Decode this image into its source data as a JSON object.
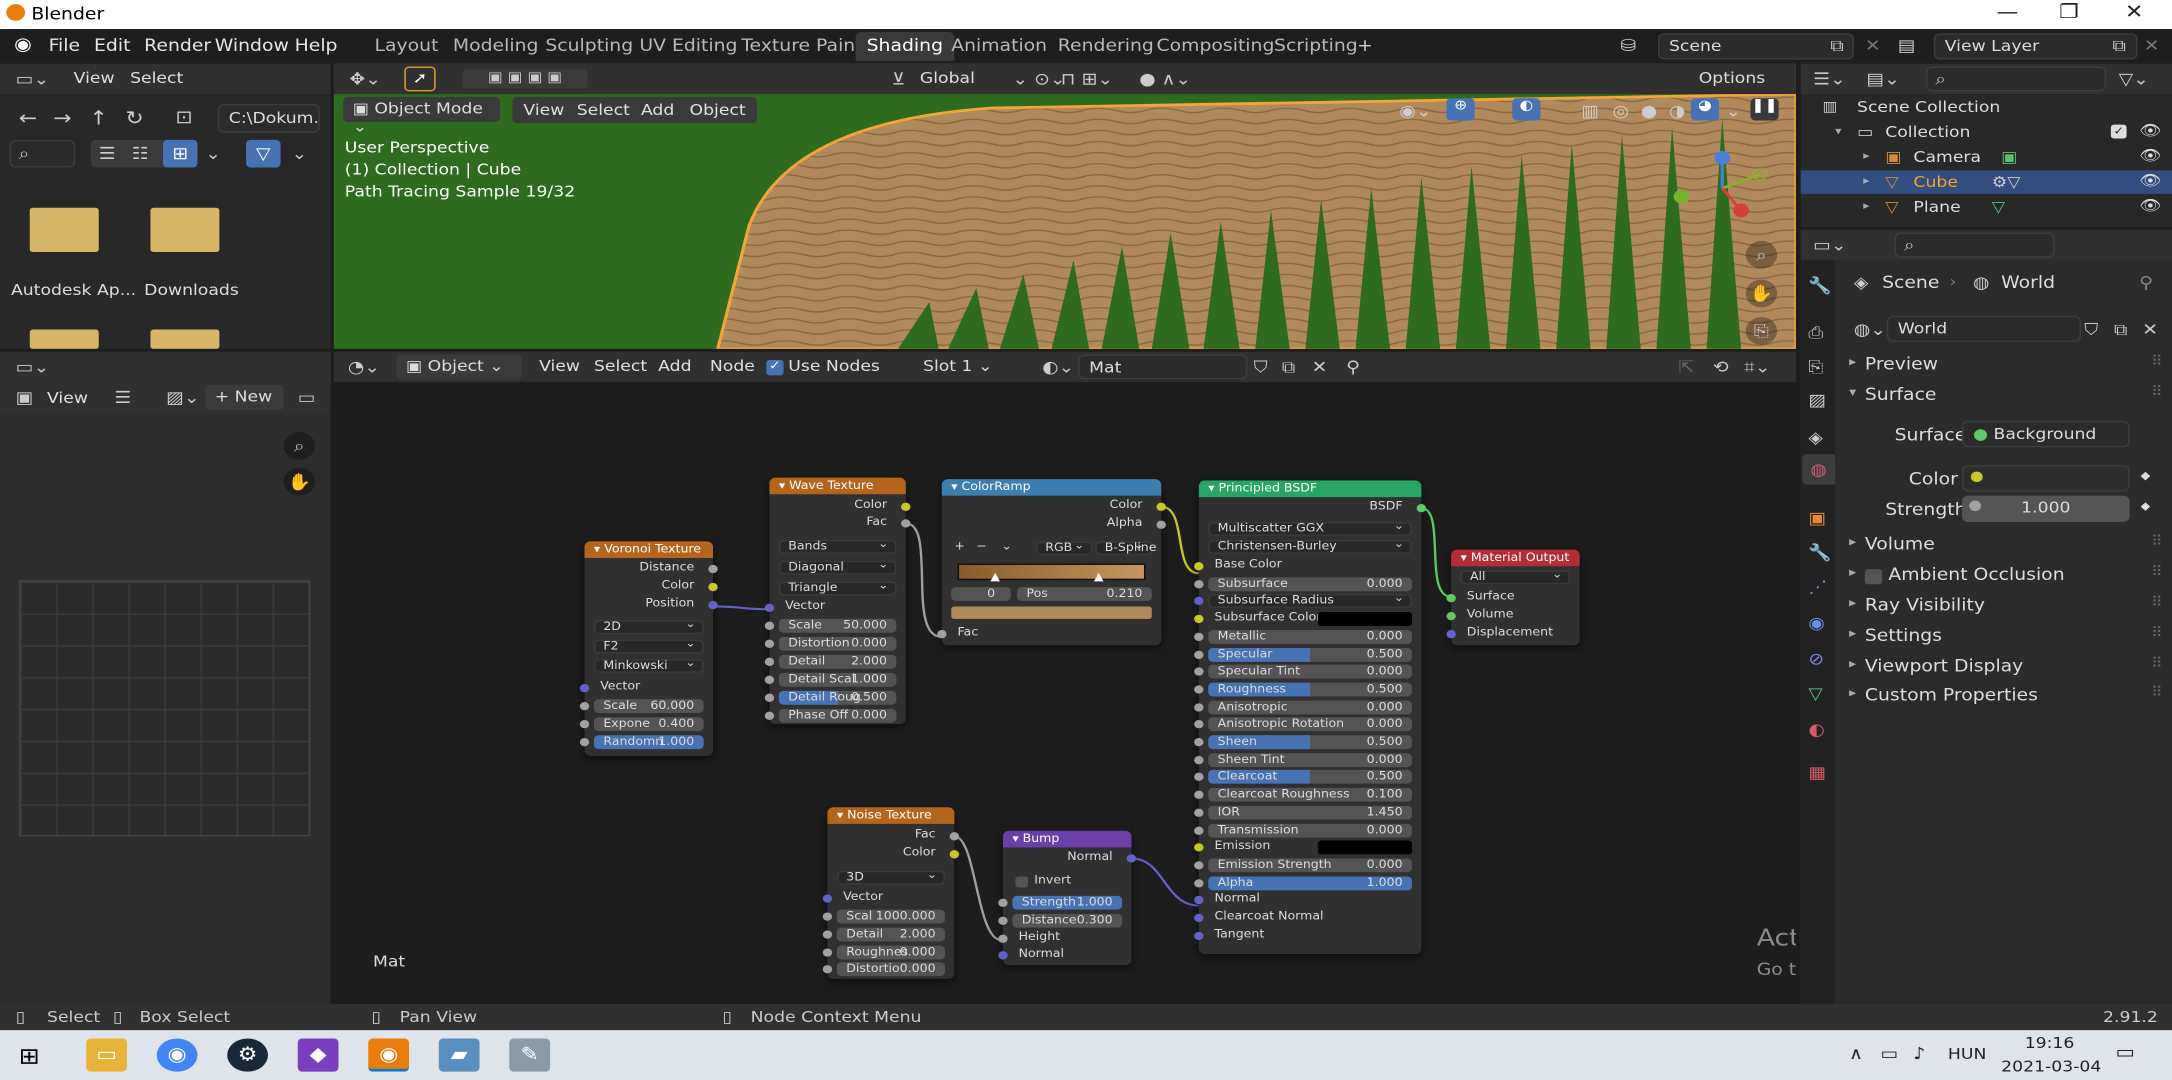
{
  "app": {
    "title": "Blender",
    "version": "2.91.2"
  },
  "menu": [
    "File",
    "Edit",
    "Render",
    "Window",
    "Help"
  ],
  "workspaces": [
    "Layout",
    "Modeling",
    "Sculpting",
    "UV Editing",
    "Texture Paint",
    "Shading",
    "Animation",
    "Rendering",
    "Compositing",
    "Scripting"
  ],
  "active_workspace": "Shading",
  "scene": "Scene",
  "view_layer": "View Layer",
  "filebrowser": {
    "view_label": "View",
    "select_label": "Select",
    "path": "C:\\Dokum...",
    "items": [
      {
        "label": "Autodesk Ap..."
      },
      {
        "label": "Downloads"
      }
    ]
  },
  "imageeditor": {
    "view_label": "View",
    "new_label": "New"
  },
  "viewport": {
    "mode": "Object Mode",
    "menus": [
      "View",
      "Select",
      "Add",
      "Object"
    ],
    "orientation": "Global",
    "options_label": "Options",
    "overlay_lines": [
      "User Perspective",
      "(1) Collection | Cube",
      "Path Tracing Sample 19/32"
    ]
  },
  "node_editor": {
    "type": "Object",
    "menus": [
      "View",
      "Select",
      "Add",
      "Node"
    ],
    "use_nodes_label": "Use Nodes",
    "slot": "Slot 1",
    "material": "Mat",
    "footer_label": "Mat"
  },
  "nodes": {
    "voronoi": {
      "title": "Voronoi Texture",
      "outputs": [
        "Distance",
        "Color",
        "Position"
      ],
      "dims": "2D",
      "feature": "F2",
      "metric": "Minkowski",
      "input": "Vector",
      "sliders": [
        {
          "label": "Scale",
          "value": "60.000"
        },
        {
          "label": "Expone",
          "value": "0.400"
        },
        {
          "label": "Randomn",
          "value": "1.000"
        }
      ]
    },
    "wave": {
      "title": "Wave Texture",
      "outputs": [
        "Color",
        "Fac"
      ],
      "options": [
        "Bands",
        "Diagonal",
        "Triangle"
      ],
      "input": "Vector",
      "sliders": [
        {
          "label": "Scale",
          "value": "50.000"
        },
        {
          "label": "Distortion",
          "value": "0.000"
        },
        {
          "label": "Detail",
          "value": "2.000"
        },
        {
          "label": "Detail Scal",
          "value": "1.000"
        },
        {
          "label": "Detail Roug",
          "value": "0.500"
        },
        {
          "label": "Phase Off",
          "value": "0.000"
        }
      ]
    },
    "colorramp": {
      "title": "ColorRamp",
      "outputs": [
        "Color",
        "Alpha"
      ],
      "mode": "RGB",
      "interp": "B-Spline",
      "index": "0",
      "pos_label": "Pos",
      "pos_value": "0.210",
      "input": "Fac"
    },
    "bsdf": {
      "title": "Principled BSDF",
      "output": "BSDF",
      "distribution": "Multiscatter GGX",
      "sss_method": "Christensen-Burley",
      "rows": [
        {
          "label": "Base Color",
          "kind": "socket"
        },
        {
          "label": "Subsurface",
          "value": "0.000",
          "fill": 0
        },
        {
          "label": "Subsurface Radius",
          "kind": "dropdown"
        },
        {
          "label": "Subsurface Color",
          "kind": "color"
        },
        {
          "label": "Metallic",
          "value": "0.000",
          "fill": 0
        },
        {
          "label": "Specular",
          "value": "0.500",
          "fill": 0.5
        },
        {
          "label": "Specular Tint",
          "value": "0.000",
          "fill": 0
        },
        {
          "label": "Roughness",
          "value": "0.500",
          "fill": 0.5
        },
        {
          "label": "Anisotropic",
          "value": "0.000",
          "fill": 0
        },
        {
          "label": "Anisotropic Rotation",
          "value": "0.000",
          "fill": 0
        },
        {
          "label": "Sheen",
          "value": "0.500",
          "fill": 0.5
        },
        {
          "label": "Sheen Tint",
          "value": "0.000",
          "fill": 0
        },
        {
          "label": "Clearcoat",
          "value": "0.500",
          "fill": 0.5
        },
        {
          "label": "Clearcoat Roughness",
          "value": "0.100",
          "fill": 0.03
        },
        {
          "label": "IOR",
          "value": "1.450",
          "fill": 0
        },
        {
          "label": "Transmission",
          "value": "0.000",
          "fill": 0
        },
        {
          "label": "Emission",
          "kind": "color"
        },
        {
          "label": "Emission Strength",
          "value": "0.000",
          "fill": 0
        },
        {
          "label": "Alpha",
          "value": "1.000",
          "fill": 1
        },
        {
          "label": "Normal",
          "kind": "socket"
        },
        {
          "label": "Clearcoat Normal",
          "kind": "socket"
        },
        {
          "label": "Tangent",
          "kind": "socket"
        }
      ]
    },
    "output": {
      "title": "Material Output",
      "target": "All",
      "inputs": [
        "Surface",
        "Volume",
        "Displacement"
      ]
    },
    "noise": {
      "title": "Noise Texture",
      "outputs": [
        "Fac",
        "Color"
      ],
      "dims": "3D",
      "input": "Vector",
      "sliders": [
        {
          "label": "Scal",
          "value": "1000.000"
        },
        {
          "label": "Detail",
          "value": "2.000"
        },
        {
          "label": "Roughnes",
          "value": "0.000"
        },
        {
          "label": "Distortio",
          "value": "0.000"
        }
      ]
    },
    "bump": {
      "title": "Bump",
      "output": "Normal",
      "invert_label": "Invert",
      "sliders": [
        {
          "label": "Strength",
          "value": "1.000"
        },
        {
          "label": "Distance",
          "value": "0.300"
        }
      ],
      "inputs": [
        "Height",
        "Normal"
      ]
    }
  },
  "outliner": {
    "items": [
      {
        "label": "Scene Collection"
      },
      {
        "label": "Collection"
      },
      {
        "label": "Camera"
      },
      {
        "label": "Cube"
      },
      {
        "label": "Plane"
      }
    ]
  },
  "properties": {
    "breadcrumb": [
      "Scene",
      "World"
    ],
    "world_name": "World",
    "sections": [
      "Preview",
      "Surface",
      "Volume",
      "Ambient Occlusion",
      "Ray Visibility",
      "Settings",
      "Viewport Display",
      "Custom Properties"
    ],
    "surface_label": "Surface",
    "surface_value": "Background",
    "color_label": "Color",
    "strength_label": "Strength",
    "strength_value": "1.000"
  },
  "statusbar": {
    "items": [
      "Select",
      "Box Select",
      "Pan View",
      "Node Context Menu"
    ]
  },
  "watermark": {
    "line1": "Activate Windows",
    "line2": "Go to Settings to activate Windows."
  },
  "taskbar": {
    "lang": "HUN",
    "time": "19:16",
    "date": "2021-03-04"
  },
  "colors": {
    "accent": "#4772b3",
    "selected_row": "#334d80",
    "wood": "#b0895a",
    "grass": "#2e6b1e"
  }
}
